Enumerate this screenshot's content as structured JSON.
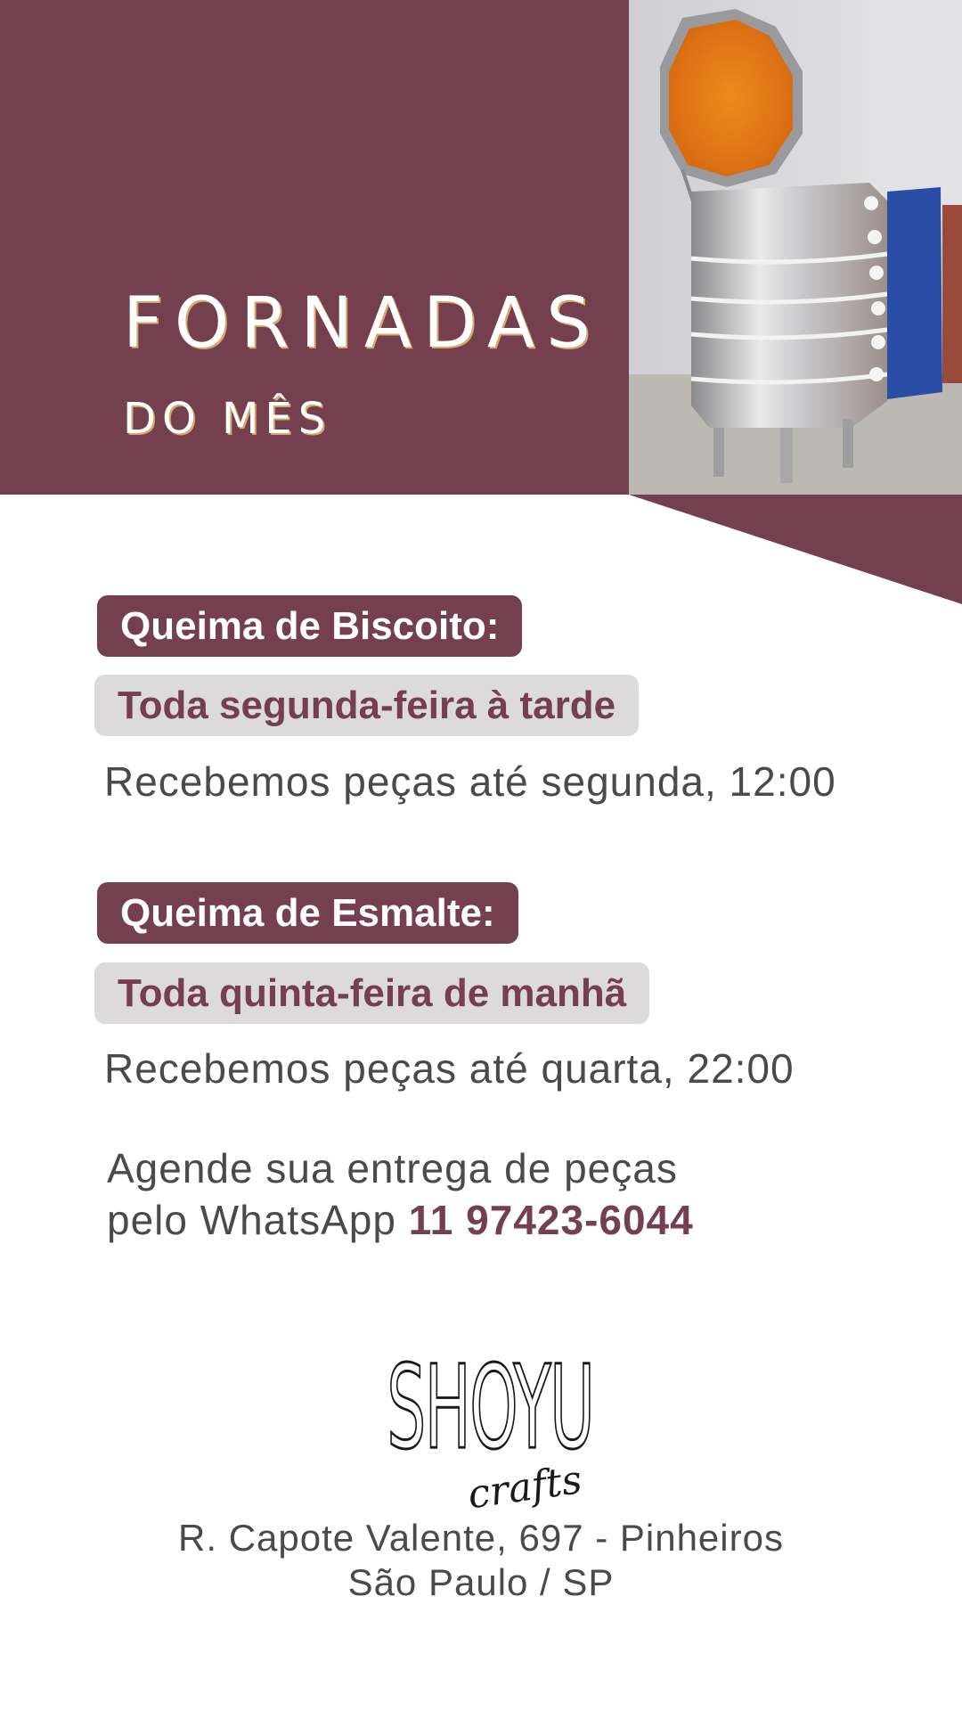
{
  "header": {
    "title": "FORNADAS",
    "subtitle": "DO MÊS"
  },
  "colors": {
    "brand": "#743f4f",
    "pill_grey": "#dcdadb",
    "text": "#4a4a4a"
  },
  "firings": [
    {
      "label": "Queima de Biscoito:",
      "day": "Toda segunda-feira à tarde",
      "deadline": "Recebemos peças até segunda, 12:00"
    },
    {
      "label": "Queima de Esmalte:",
      "day": "Toda quinta-feira de manhã",
      "deadline": "Recebemos peças até quarta, 22:00"
    }
  ],
  "schedule": {
    "line1": "Agende sua entrega de peças",
    "line2_prefix": "pelo WhatsApp",
    "phone": "11 97423-6044"
  },
  "logo": {
    "brand": "SHOYU",
    "tagline": "crafts"
  },
  "address": {
    "line1": "R. Capote Valente, 697 - Pinheiros",
    "line2": "São Paulo / SP"
  }
}
